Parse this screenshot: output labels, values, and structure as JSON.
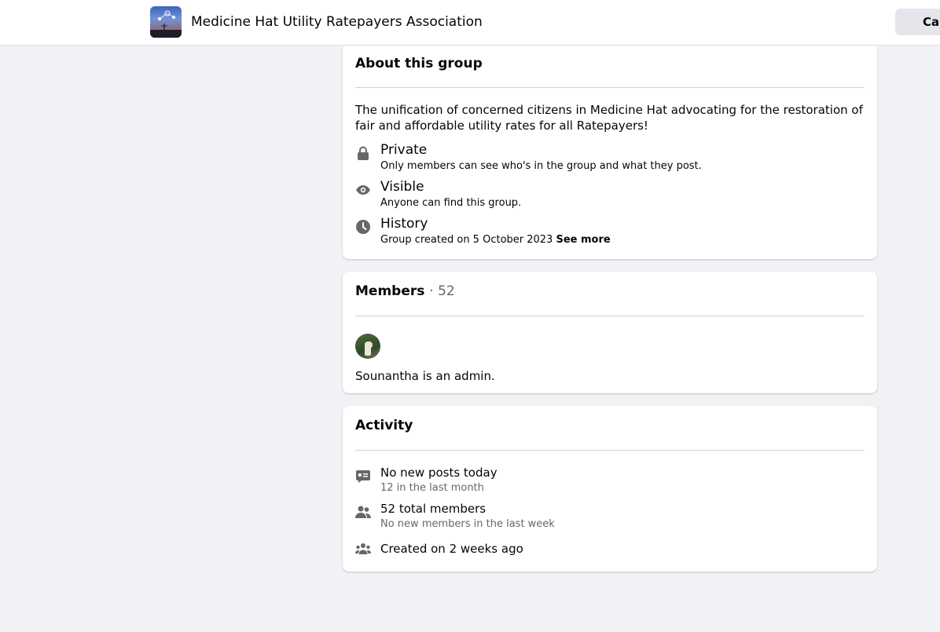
{
  "header": {
    "group_name": "Medicine Hat Utility Ratepayers Association",
    "cancel_label": "Cancel"
  },
  "about": {
    "title": "About this group",
    "description": "The unification of concerned citizens in Medicine Hat advocating for the restoration of fair and affordable utility rates for all Ratepayers!",
    "privacy": {
      "title": "Private",
      "text": "Only members can see who's in the group and what they post."
    },
    "visibility": {
      "title": "Visible",
      "text": "Anyone can find this group."
    },
    "history": {
      "title": "History",
      "text": "Group created on 5 October 2023",
      "link": "See more"
    }
  },
  "members": {
    "title": "Members",
    "count": "· 52",
    "admin_text": "Sounantha is an admin."
  },
  "activity": {
    "title": "Activity",
    "posts": {
      "title": "No new posts today",
      "sub": "12 in the last month"
    },
    "total": {
      "title": "52 total members",
      "sub": "No new members in the last week"
    },
    "created": {
      "title": "Created on 2 weeks ago"
    }
  },
  "icons": {
    "lock": "lock-icon",
    "eye": "eye-icon",
    "clock": "clock-icon",
    "chat": "chat-bubble-icon",
    "people": "two-people-icon",
    "group": "group-icon"
  },
  "colors": {
    "icon_gray": "#65676b",
    "background": "#f0f2f5",
    "divider": "#ced0d4"
  }
}
